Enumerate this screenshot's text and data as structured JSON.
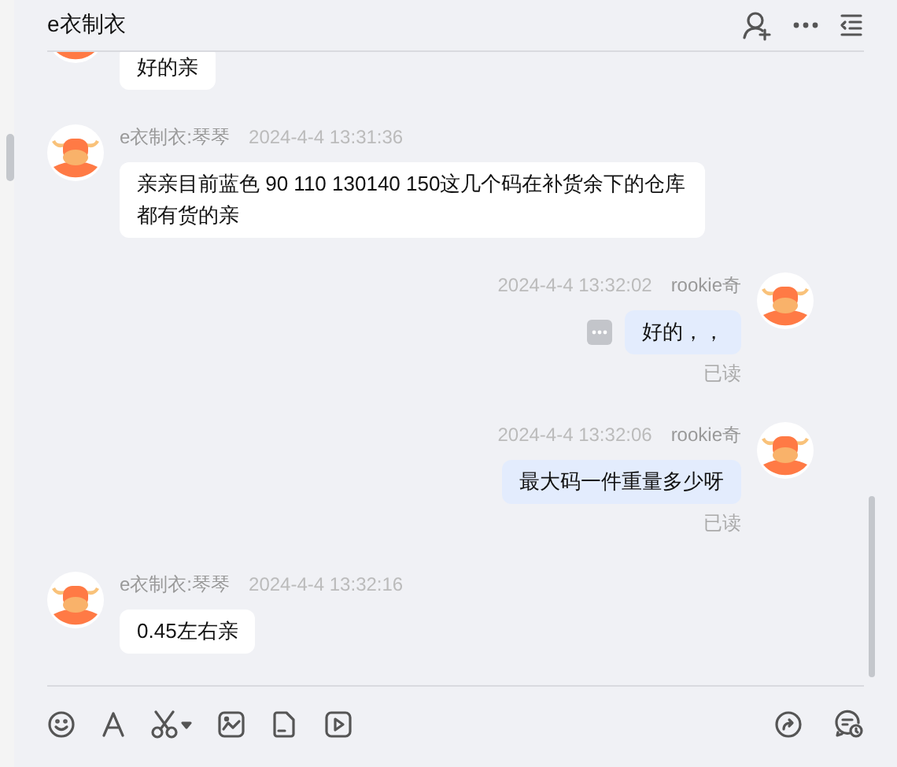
{
  "header": {
    "title": "e衣制衣"
  },
  "messages": [
    {
      "kind": "received",
      "text": "好的亲"
    },
    {
      "kind": "received",
      "sender": "e衣制衣:琴琴",
      "time": "2024-4-4 13:31:36",
      "text": "亲亲目前蓝色 90 110 130140 150这几个码在补货余下的仓库都有货的亲"
    },
    {
      "kind": "sent",
      "sender": "rookie奇",
      "time": "2024-4-4 13:32:02",
      "text": "好的，，",
      "more": true,
      "status": "已读"
    },
    {
      "kind": "sent",
      "sender": "rookie奇",
      "time": "2024-4-4 13:32:06",
      "text": "最大码一件重量多少呀",
      "more": false,
      "status": "已读"
    },
    {
      "kind": "received",
      "sender": "e衣制衣:琴琴",
      "time": "2024-4-4 13:32:16",
      "text": "0.45左右亲"
    }
  ]
}
